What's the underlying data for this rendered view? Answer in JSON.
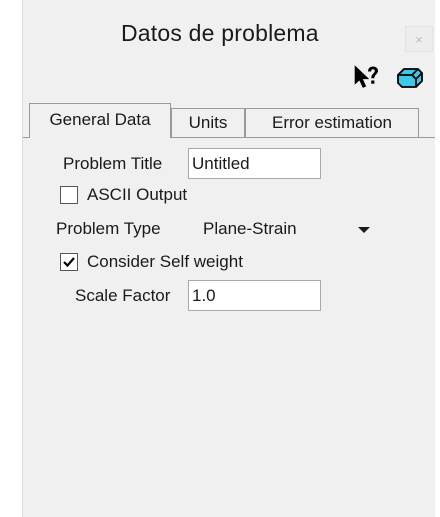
{
  "window": {
    "title": "Datos de problema",
    "close_label": "×"
  },
  "toolbar": {
    "help_icon": "whats-this-help-icon",
    "eraser_icon": "eraser-icon"
  },
  "tabs": [
    {
      "label": "General Data",
      "active": true
    },
    {
      "label": "Units",
      "active": false
    },
    {
      "label": "Error estimation",
      "active": false
    }
  ],
  "general": {
    "problem_title_label": "Problem Title",
    "problem_title_value": "Untitled",
    "ascii_output_label": "ASCII Output",
    "ascii_output_checked": false,
    "problem_type_label": "Problem Type",
    "problem_type_value": "Plane-Strain",
    "self_weight_label": "Consider Self weight",
    "self_weight_checked": true,
    "scale_factor_label": "Scale Factor",
    "scale_factor_value": "1.0"
  }
}
